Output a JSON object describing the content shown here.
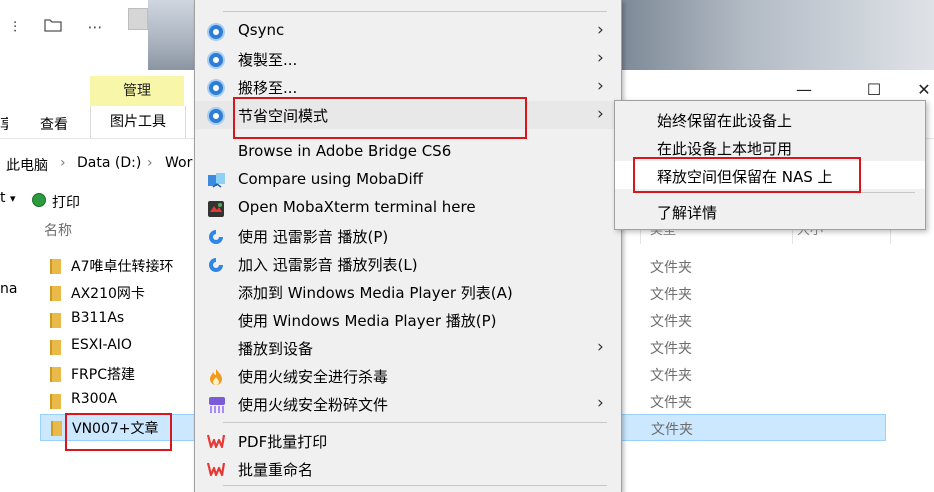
{
  "explorer": {
    "ribbon": {
      "manage_tab": "管理",
      "picture_tools_tab": "图片工具",
      "view_tab": "查看",
      "cut_tab": "享"
    },
    "quick_access": {
      "more_icon": "⋯"
    },
    "address": {
      "pc": "此电脑",
      "drive": "Data (D:)",
      "folder": "Wor"
    },
    "toolbar": {
      "left_cut": "t",
      "print": "打印"
    },
    "columns": {
      "name": "名称",
      "type": "类型",
      "size": "大小"
    },
    "left_pane_cut": "na",
    "files": [
      {
        "name": "A7唯卓仕转接环",
        "type": "文件夹"
      },
      {
        "name": "AX210网卡",
        "type": "文件夹"
      },
      {
        "name": "B311As",
        "type": "文件夹"
      },
      {
        "name": "ESXI-AIO",
        "type": "文件夹"
      },
      {
        "name": "FRPC搭建",
        "type": "文件夹"
      },
      {
        "name": "R300A",
        "type": "文件夹"
      },
      {
        "name": "VN007+文章",
        "type": "文件夹"
      }
    ],
    "window_controls": {
      "minimize": "—",
      "maximize": "☐",
      "close": "✕"
    }
  },
  "context_menu": {
    "items": [
      {
        "label": "Qsync",
        "icon": "qsync-icon",
        "submenu": true
      },
      {
        "label": "複製至...",
        "icon": "qsync-icon",
        "submenu": true
      },
      {
        "label": "搬移至...",
        "icon": "qsync-icon",
        "submenu": true
      },
      {
        "label": "节省空间模式",
        "icon": "qsync-icon",
        "submenu": true
      },
      {
        "label": "Browse in Adobe Bridge CS6",
        "icon": ""
      },
      {
        "label": "Compare using MobaDiff",
        "icon": "mobadiff-icon"
      },
      {
        "label": "Open MobaXterm terminal here",
        "icon": "mobaxterm-icon"
      },
      {
        "label": "使用 迅雷影音 播放(P)",
        "icon": "xunlei-icon"
      },
      {
        "label": "加入 迅雷影音 播放列表(L)",
        "icon": "xunlei-icon"
      },
      {
        "label": "添加到 Windows Media Player 列表(A)",
        "icon": ""
      },
      {
        "label": "使用 Windows Media Player 播放(P)",
        "icon": ""
      },
      {
        "label": "播放到设备",
        "icon": "",
        "submenu": true
      },
      {
        "label": "使用火绒安全进行杀毒",
        "icon": "huorong-icon"
      },
      {
        "label": "使用火绒安全粉碎文件",
        "icon": "shredder-icon",
        "submenu": true
      },
      {
        "label": "PDF批量打印",
        "icon": "wps-icon"
      },
      {
        "label": "批量重命名",
        "icon": "wps-icon"
      }
    ]
  },
  "submenu": {
    "items": [
      {
        "label": "始终保留在此设备上"
      },
      {
        "label": "在此设备上本地可用"
      },
      {
        "label": "释放空间但保留在 NAS 上"
      },
      {
        "label": "了解详情"
      }
    ]
  },
  "colors": {
    "highlight_red": "#d8161b",
    "selection": "#cce8ff",
    "manage_tab_bg": "#f7f6a9",
    "folder": "#e9b949"
  }
}
